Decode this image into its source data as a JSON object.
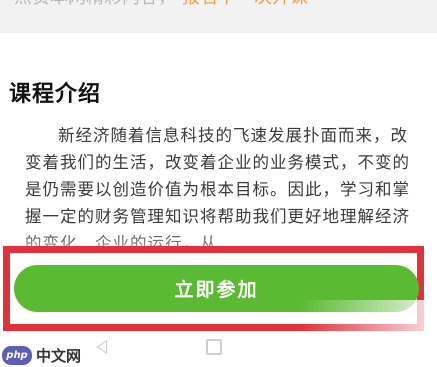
{
  "top_strip": {
    "text": "点赞本网精彩内容，",
    "accent": "报名下一次开课"
  },
  "section": {
    "title": "课程介绍",
    "description": "新经济随着信息科技的飞速发展扑面而来，改变着我们的生活，改变着企业的业务模式，不变的是仍需要以创造价值为根本目标。因此，学习和掌握一定的财务管理知识将帮助我们更好地理解经济的变化、企业的运行，从"
  },
  "cta": {
    "label": "立即参加"
  },
  "watermark": {
    "badge": "php",
    "text": "中文网"
  },
  "colors": {
    "button_green": "#5aba31",
    "highlight_red": "#e1313a",
    "accent_orange": "#f0a04b"
  }
}
